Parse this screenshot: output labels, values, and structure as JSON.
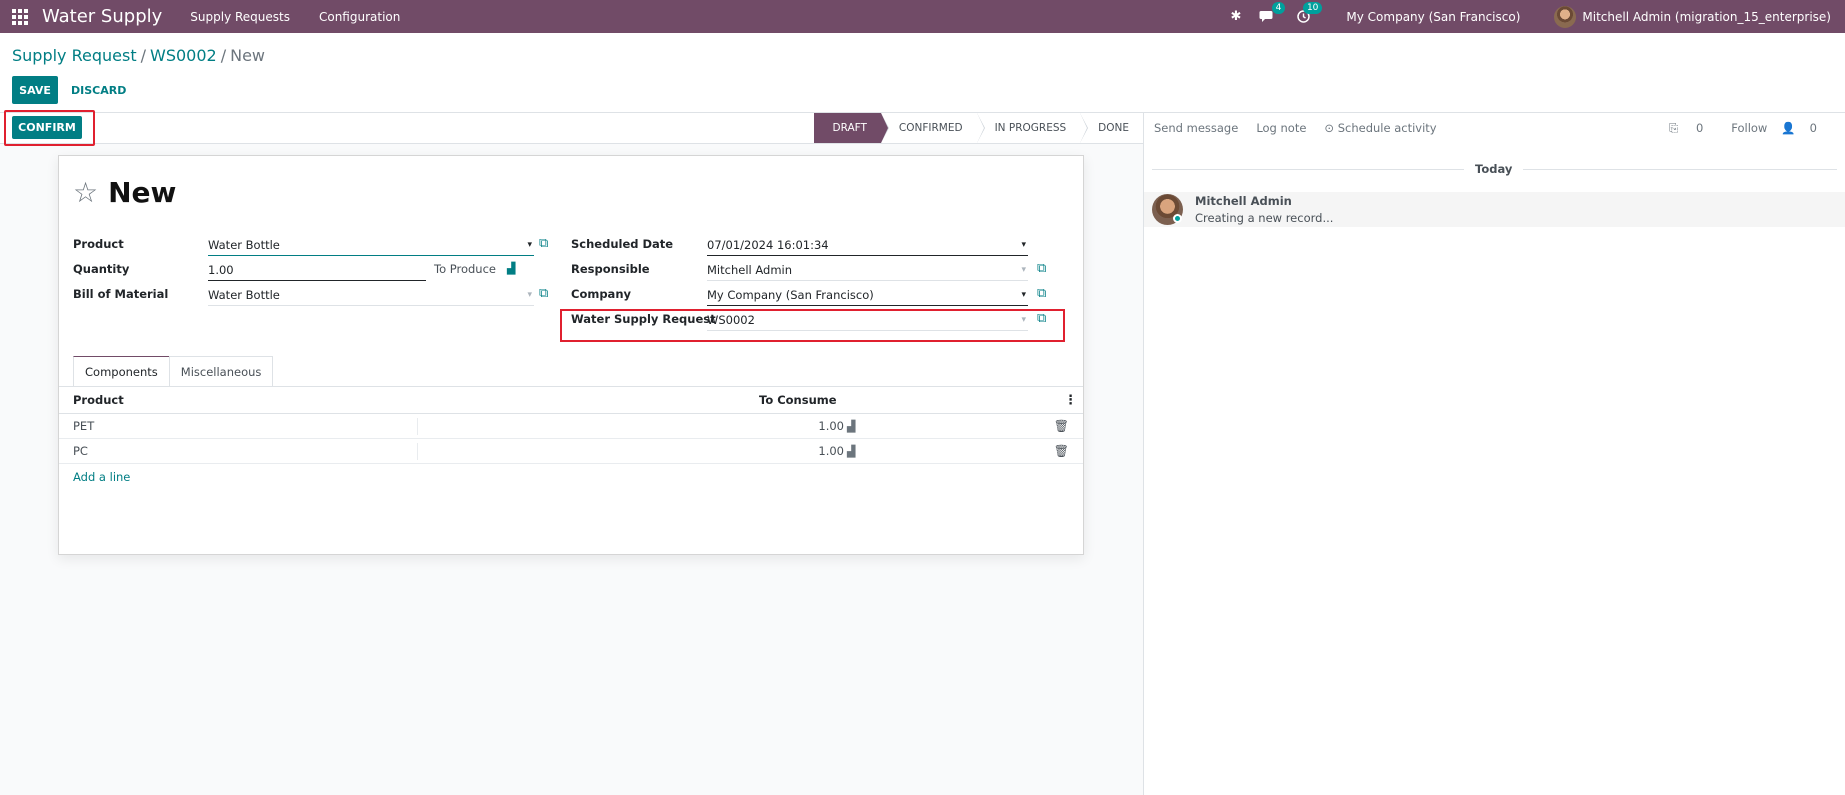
{
  "navbar": {
    "brand": "Water Supply",
    "menus": [
      "Supply Requests",
      "Configuration"
    ],
    "messages_badge": "4",
    "activities_badge": "10",
    "company": "My Company (San Francisco)",
    "user": "Mitchell Admin (migration_15_enterprise)",
    "bg_color": "#714b67"
  },
  "breadcrumb": {
    "items": [
      "Supply Request",
      "WS0002"
    ],
    "current": "New"
  },
  "buttons": {
    "save": "SAVE",
    "discard": "DISCARD",
    "confirm": "CONFIRM"
  },
  "statusbar": {
    "stages": [
      "DRAFT",
      "CONFIRMED",
      "IN PROGRESS",
      "DONE"
    ],
    "active": "DRAFT"
  },
  "record": {
    "title": "New"
  },
  "fields": {
    "product_label": "Product",
    "product_value": "Water Bottle",
    "quantity_label": "Quantity",
    "quantity_value": "1.00",
    "to_produce": "To Produce",
    "bom_label": "Bill of Material",
    "bom_value": "Water Bottle",
    "scheduled_label": "Scheduled Date",
    "scheduled_value": "07/01/2024 16:01:34",
    "responsible_label": "Responsible",
    "responsible_value": "Mitchell Admin",
    "company_label": "Company",
    "company_value": "My Company (San Francisco)",
    "wsr_label": "Water Supply Request",
    "wsr_value": "WS0002"
  },
  "tabs": [
    "Components",
    "Miscellaneous"
  ],
  "components": {
    "headers": {
      "product": "Product",
      "to_consume": "To Consume"
    },
    "rows": [
      {
        "product": "PET",
        "qty": "1.00"
      },
      {
        "product": "PC",
        "qty": "1.00"
      }
    ],
    "add_line": "Add a line"
  },
  "chatter": {
    "send_message": "Send message",
    "log_note": "Log note",
    "schedule_activity": "Schedule activity",
    "attachments": "0",
    "follow": "Follow",
    "followers": "0",
    "today": "Today",
    "message_author": "Mitchell Admin",
    "message_body": "Creating a new record..."
  },
  "colors": {
    "primary": "#017e84",
    "brand": "#714b67",
    "highlight": "#e0202f"
  }
}
